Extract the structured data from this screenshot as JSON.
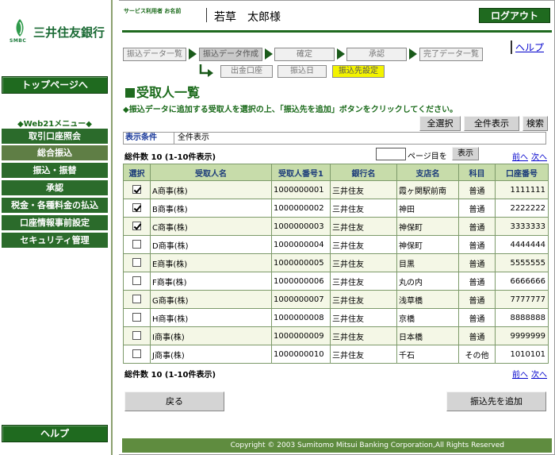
{
  "bank": {
    "name": "三井住友銀行",
    "abbr": "SMBC"
  },
  "sidebar": {
    "top_page": "トップページへ",
    "menu_title": "◆Web21メニュー◆",
    "items": [
      {
        "label": "取引口座照会",
        "active": false
      },
      {
        "label": "総合振込",
        "active": true
      },
      {
        "label": "振込・振替",
        "active": false
      },
      {
        "label": "承認",
        "active": false
      },
      {
        "label": "税金・各種料金の払込",
        "active": false
      },
      {
        "label": "口座情報事前設定",
        "active": false
      },
      {
        "label": "セキュリティ管理",
        "active": false
      }
    ],
    "help": "ヘルプ"
  },
  "header": {
    "user_label": "サービス利用者 お名前",
    "user_name": "若草　太郎様",
    "logout": "ログアウト",
    "help_link": "ヘルプ"
  },
  "steps": [
    "振込データ一覧",
    "振込データ作成",
    "確定",
    "承認",
    "完了データ一覧"
  ],
  "substeps": [
    "出金口座",
    "振込日",
    "振込先設定"
  ],
  "page": {
    "title": "受取人一覧",
    "instruction": "◆振込データに追加する受取人を選択の上、「振込先を追加」ボタンをクリックしてください。"
  },
  "actions": {
    "select_all": "全選択",
    "show_all": "全件表示",
    "search": "検索"
  },
  "filter": {
    "label": "表示条件",
    "value": "全件表示"
  },
  "paging": {
    "count_text": "総件数 10 (1-10件表示)",
    "page_suffix": "ページ目を",
    "show": "表示",
    "prev": "前へ",
    "next": "次へ"
  },
  "table": {
    "headers": [
      "選択",
      "受取人名",
      "受取人番号1",
      "銀行名",
      "支店名",
      "科目",
      "口座番号"
    ],
    "rows": [
      {
        "checked": true,
        "name": "A商事(株)",
        "number": "1000000001",
        "bank": "三井住友",
        "branch": "霞ヶ関駅前南",
        "type": "普通",
        "account": "1111111"
      },
      {
        "checked": true,
        "name": "B商事(株)",
        "number": "1000000002",
        "bank": "三井住友",
        "branch": "神田",
        "type": "普通",
        "account": "2222222"
      },
      {
        "checked": true,
        "name": "C商事(株)",
        "number": "1000000003",
        "bank": "三井住友",
        "branch": "神保町",
        "type": "普通",
        "account": "3333333"
      },
      {
        "checked": false,
        "name": "D商事(株)",
        "number": "1000000004",
        "bank": "三井住友",
        "branch": "神保町",
        "type": "普通",
        "account": "4444444"
      },
      {
        "checked": false,
        "name": "E商事(株)",
        "number": "1000000005",
        "bank": "三井住友",
        "branch": "目黒",
        "type": "普通",
        "account": "5555555"
      },
      {
        "checked": false,
        "name": "F商事(株)",
        "number": "1000000006",
        "bank": "三井住友",
        "branch": "丸の内",
        "type": "普通",
        "account": "6666666"
      },
      {
        "checked": false,
        "name": "G商事(株)",
        "number": "1000000007",
        "bank": "三井住友",
        "branch": "浅草橋",
        "type": "普通",
        "account": "7777777"
      },
      {
        "checked": false,
        "name": "H商事(株)",
        "number": "1000000008",
        "bank": "三井住友",
        "branch": "京橋",
        "type": "普通",
        "account": "8888888"
      },
      {
        "checked": false,
        "name": "I商事(株)",
        "number": "1000000009",
        "bank": "三井住友",
        "branch": "日本橋",
        "type": "普通",
        "account": "9999999"
      },
      {
        "checked": false,
        "name": "J商事(株)",
        "number": "1000000010",
        "bank": "三井住友",
        "branch": "千石",
        "type": "その他",
        "account": "1010101"
      }
    ]
  },
  "buttons": {
    "back": "戻る",
    "add": "振込先を追加"
  },
  "footer": {
    "copyright": "Copyright © 2003 Sumitomo Mitsui Banking Corporation,All Rights Reserved"
  }
}
